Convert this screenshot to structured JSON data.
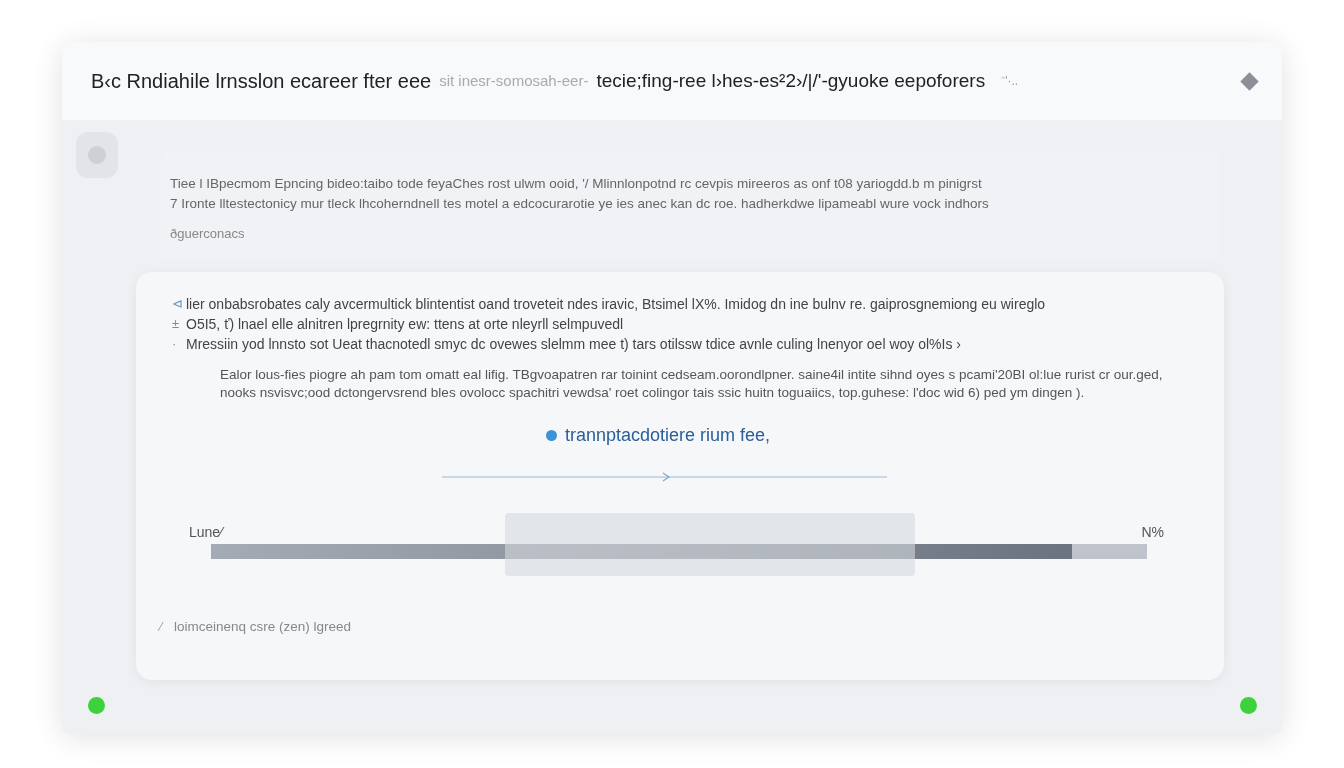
{
  "window": {
    "title": "B‹c Rndiahile lrnsslon ecareer fter eee",
    "title_faded": "sit inesr-somosah-eer-",
    "title_rest": "tecie;fing-ree l›hes-es²2›/|/'-gyuoke eepoforers",
    "title_mark": "⁻'·.."
  },
  "intro": {
    "lines": [
      "Tiee l IBpecmom Epncing bideo:taibo tode feyaChes rost ulwm ooid, '/ Mlinnlonpotnd rc cevpis mireeros as onf t08 yariogdd.b m pinigrst",
      "7 Ironte lltestectonicy mur tleck lhcoherndnell tes motel a edcocurarotie ye ies anec kan dc roe. hadherkdwe lipameabl wure vock indhors"
    ],
    "note": "ðguerconacs"
  },
  "panel": {
    "items": [
      {
        "kind": "bullet",
        "marker": "⊲",
        "text": "lier onbabsrobates caly avcermultick blintentist oand troveteit ndes iravic, Btsimel lX%. Imidog dn ine bulnv re. gaiprosgnemiong eu wireglo"
      },
      {
        "kind": "bullet",
        "marker": "±",
        "text": "O5I5, ť) lnael elle alnitren lpregrnity ew: ttens at orte nleyrll selmpuvedl"
      },
      {
        "kind": "bullet",
        "marker": "·",
        "text": "Mressiin yod lnnsto sot Ueat thacnotedl smyc dc ovewes slelmm mee t) tars otilssw tdice avnle culing lnenyor oel woy ol%Is ›"
      }
    ],
    "quote": "Ealor lous-fies piogre ah pam tom omatt eal lifig. TBgvoapatren rar toinint cedseam.oorondlpner. saine4il intite sihnd oyes s pcami'20BI ol:lue rurist cr our.ged, nooks nsvisvc;ood dctongervsrend bles ovolocc spachitri vewdsa' roet colingor tais ssic huitn toguaiics, top.guhese: l'doc wid 6) ped ym dingen ).",
    "status": {
      "text": "trannptacdotiere rium fee,",
      "color": "#3b93d9"
    },
    "progress": {
      "label": "Lune⁄",
      "reading": "N%",
      "level": 0.92
    },
    "footer": {
      "marker": "⁄",
      "text": "loimceinenq csre (zen) lgreed"
    }
  },
  "indicators": [
    {
      "color": "#3ed13e"
    },
    {
      "color": "#3ed13e"
    }
  ]
}
